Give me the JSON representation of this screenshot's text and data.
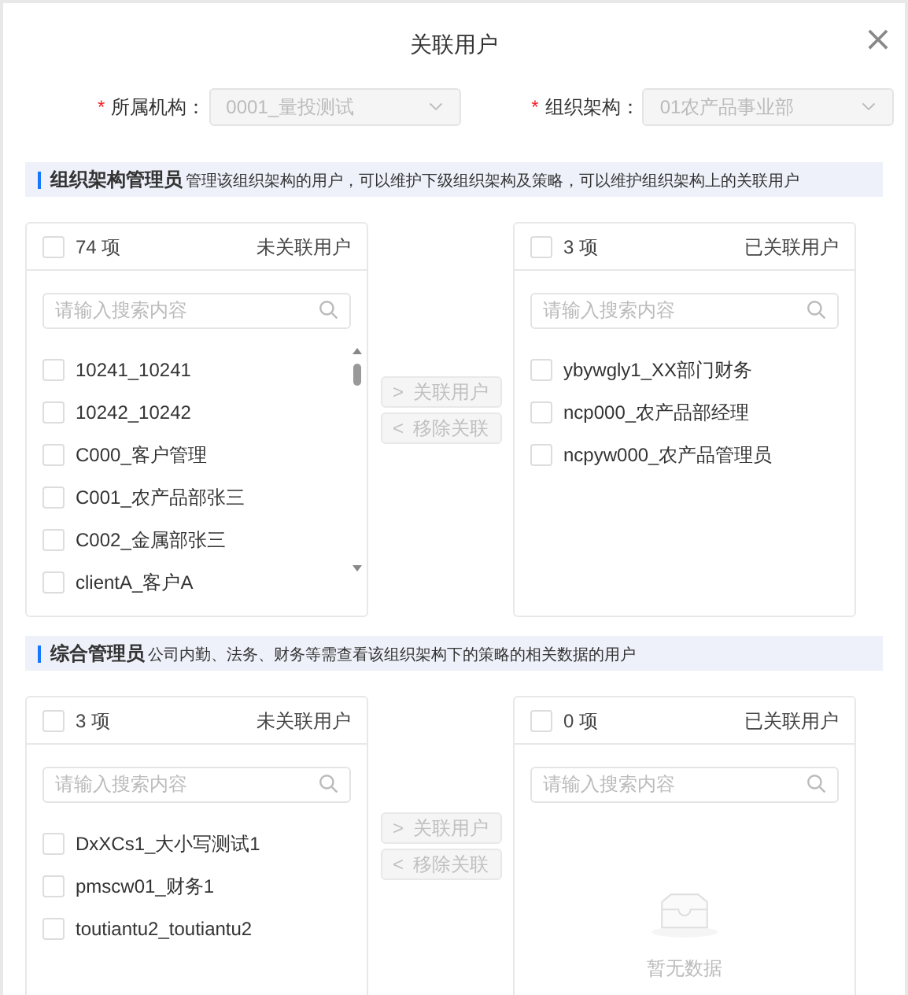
{
  "title": "关联用户",
  "close": "×",
  "fields": [
    {
      "required_mark": "*",
      "label": "所属机构：",
      "value": "0001_量投测试",
      "disabled": true
    },
    {
      "required_mark": "*",
      "label": "组织架构：",
      "value": "01农产品事业部",
      "disabled": true
    }
  ],
  "sections": [
    {
      "title": "组织架构管理员",
      "description": "管理该组织架构的用户，可以维护下级组织架构及策略，可以维护组织架构上的关联用户",
      "source": {
        "count": "74 项",
        "title": "未关联用户",
        "checked": false,
        "placeholder": "请输入搜索内容",
        "scrollbar": true,
        "items": [
          {
            "label": "10241_10241",
            "checked": false
          },
          {
            "label": "10242_10242",
            "checked": false
          },
          {
            "label": "C000_客户管理",
            "checked": false
          },
          {
            "label": "C001_农产品部张三",
            "checked": false
          },
          {
            "label": "C002_金属部张三",
            "checked": false
          },
          {
            "label": "clientA_客户A",
            "checked": false
          }
        ]
      },
      "buttons": [
        {
          "icon": ">",
          "label": "关联用户",
          "disabled": true
        },
        {
          "icon": "<",
          "label": "移除关联",
          "disabled": true
        }
      ],
      "target": {
        "count": "3 项",
        "title": "已关联用户",
        "checked": false,
        "placeholder": "请输入搜索内容",
        "items": [
          {
            "label": "ybywgly1_XX部门财务",
            "checked": false
          },
          {
            "label": "ncp000_农产品部经理",
            "checked": false
          },
          {
            "label": "ncpyw000_农产品管理员",
            "checked": false
          }
        ]
      }
    },
    {
      "title": "综合管理员",
      "description": "公司内勤、法务、财务等需查看该组织架构下的策略的相关数据的用户",
      "source": {
        "count": "3 项",
        "title": "未关联用户",
        "checked": false,
        "placeholder": "请输入搜索内容",
        "items": [
          {
            "label": "DxXCs1_大小写测试1",
            "checked": false
          },
          {
            "label": "pmscw01_财务1",
            "checked": false
          },
          {
            "label": "toutiantu2_toutiantu2",
            "checked": false
          }
        ]
      },
      "buttons": [
        {
          "icon": ">",
          "label": "关联用户",
          "disabled": true
        },
        {
          "icon": "<",
          "label": "移除关联",
          "disabled": true
        }
      ],
      "target": {
        "count": "0 项",
        "title": "已关联用户",
        "checked": false,
        "placeholder": "请输入搜索内容",
        "empty_text": "暂无数据"
      }
    }
  ]
}
